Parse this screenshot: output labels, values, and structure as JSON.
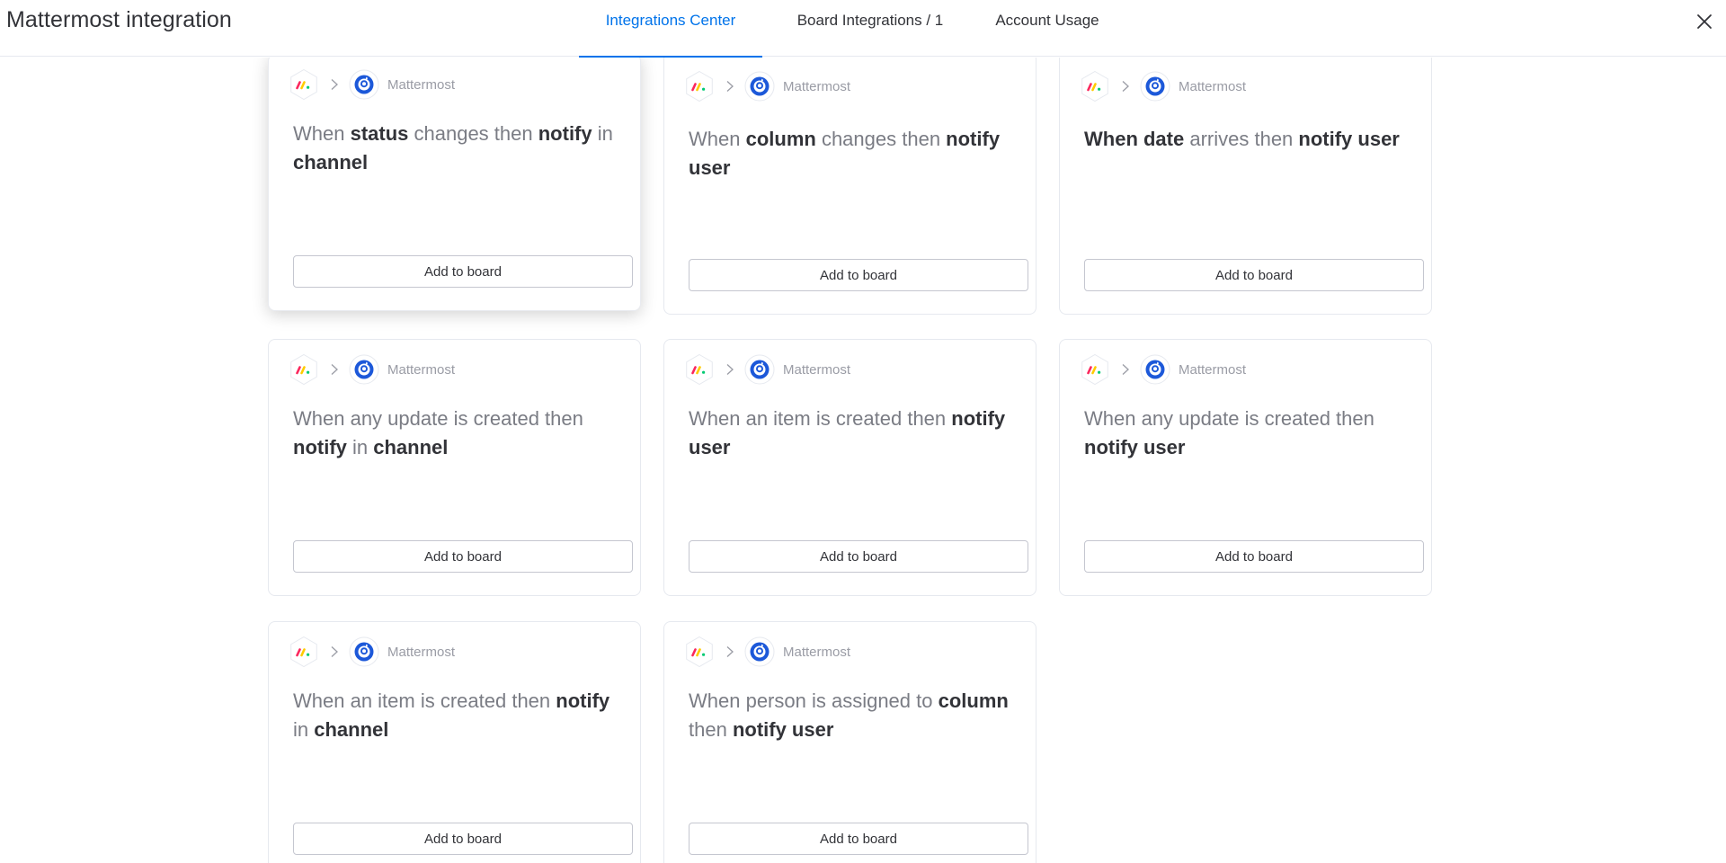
{
  "header": {
    "title": "Mattermost integration",
    "tabs": [
      {
        "label": "Integrations Center",
        "active": true
      },
      {
        "label": "Board Integrations / 1",
        "active": false
      },
      {
        "label": "Account Usage",
        "active": false
      }
    ]
  },
  "colors": {
    "accent": "#0073ea",
    "mattermost_blue": "#1c58d9",
    "text_dark": "#323338",
    "text_light": "#7a7c84"
  },
  "cards": [
    {
      "provider": "Mattermost",
      "button": "Add to board",
      "recipe": [
        {
          "t": "When ",
          "b": false
        },
        {
          "t": "status",
          "b": true
        },
        {
          "t": " changes then ",
          "b": false
        },
        {
          "t": "notify",
          "b": true
        },
        {
          "t": " in ",
          "b": false
        },
        {
          "t": "channel",
          "b": true
        }
      ]
    },
    {
      "provider": "Mattermost",
      "button": "Add to board",
      "recipe": [
        {
          "t": "When ",
          "b": false
        },
        {
          "t": "column",
          "b": true
        },
        {
          "t": " changes then ",
          "b": false
        },
        {
          "t": "notify user",
          "b": true
        }
      ]
    },
    {
      "provider": "Mattermost",
      "button": "Add to board",
      "recipe": [
        {
          "t": "When date",
          "b": true
        },
        {
          "t": " arrives then ",
          "b": false
        },
        {
          "t": "notify user",
          "b": true
        }
      ]
    },
    {
      "provider": "Mattermost",
      "button": "Add to board",
      "recipe": [
        {
          "t": "When any update is created then ",
          "b": false
        },
        {
          "t": "notify",
          "b": true
        },
        {
          "t": " in ",
          "b": false
        },
        {
          "t": "channel",
          "b": true
        }
      ]
    },
    {
      "provider": "Mattermost",
      "button": "Add to board",
      "recipe": [
        {
          "t": "When an item is created then ",
          "b": false
        },
        {
          "t": "notify user",
          "b": true
        }
      ]
    },
    {
      "provider": "Mattermost",
      "button": "Add to board",
      "recipe": [
        {
          "t": "When any update is created then ",
          "b": false
        },
        {
          "t": "notify user",
          "b": true
        }
      ]
    },
    {
      "provider": "Mattermost",
      "button": "Add to board",
      "recipe": [
        {
          "t": "When an item is created then ",
          "b": false
        },
        {
          "t": "notify",
          "b": true
        },
        {
          "t": " in ",
          "b": false
        },
        {
          "t": "channel",
          "b": true
        }
      ]
    },
    {
      "provider": "Mattermost",
      "button": "Add to board",
      "recipe": [
        {
          "t": "When person is assigned to ",
          "b": false
        },
        {
          "t": "column",
          "b": true
        },
        {
          "t": " then ",
          "b": false
        },
        {
          "t": "notify user",
          "b": true
        }
      ]
    }
  ],
  "icons": {
    "source": "monday-logo-icon",
    "arrow": "chevron-right-icon",
    "target": "mattermost-logo-icon",
    "close": "close-icon"
  }
}
